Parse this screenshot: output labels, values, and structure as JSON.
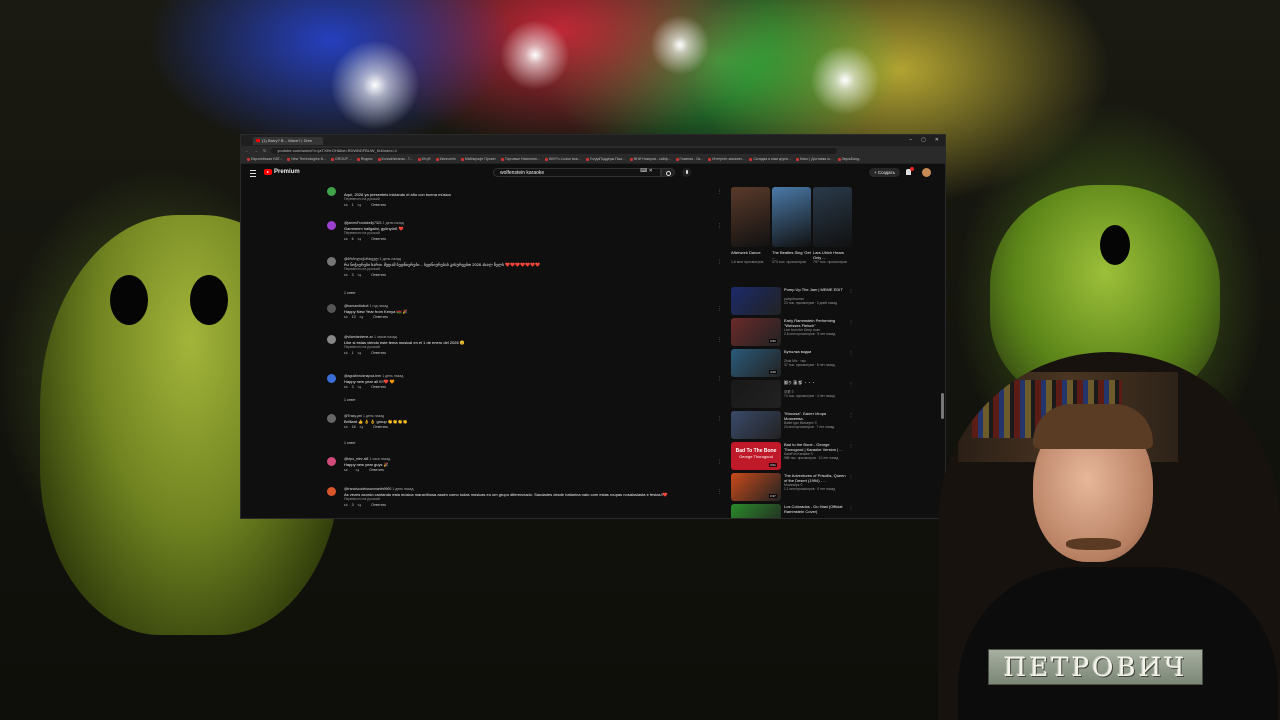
{
  "browser": {
    "tab_title": "(1) Barry? B... Wave? | Dhm",
    "url": "youtube.com/watch?v=jaTXlHrOH&list=RDWBDFBUW_Kl&index=1",
    "bookmarks": [
      "Европейская НАТ...",
      "New Technologies N...",
      "GROUP ...",
      "Яндекс",
      "КолоаИкеанак - Т...",
      "Ютуб",
      "Mannzmin",
      "Майнкрафт Проект",
      "Торговые Нахеолин...",
      "Will Fu Loulue мок...",
      "ГолдаПоддерж.Пыа...",
      "ВНИ Никоров - кайф...",
      "Главная - Ок...",
      "Интернет-магазин...",
      "Складка и коки кругм...",
      "Мясо | Доставка м...",
      "ЗвукаБанд.."
    ],
    "window_controls": [
      "–",
      "▢",
      "✕"
    ]
  },
  "youtube": {
    "logo": "Premium",
    "search_value": "wolfenstein karaoke",
    "create_label": "+ Создать"
  },
  "comments": [
    {
      "user": "",
      "time": "",
      "text": "Aquí, 2026 ya presenteis iniciando el año con buena música",
      "translate": "Перевести на русский",
      "likes": "1",
      "reply": "Ответить",
      "color": "#3fa34a"
    },
    {
      "user": "@jamesFrostabelly7321",
      "time": "1 день назад",
      "text": "Gammmm hallgatni, gyönyörű ❤️",
      "translate": "Перевести на русский",
      "likes": "6",
      "reply": "Ответить",
      "color": "#9b3fcf"
    },
    {
      "user": "@ბრძოლაქართველ",
      "time": "1 день назад",
      "text": "რა ნიჭიერები ხართ. მუდამ ბედნიერები... ბედნიერებას გისურვებთ 2026 ახალ წელს ❤️❤️❤️❤️❤️❤️❤️",
      "translate": "Перевести на русский",
      "likes": "3",
      "reply": "Ответить",
      "color": "#777777"
    },
    {
      "user": "@kamandiabu4",
      "time": "1 год назад",
      "text": "Happy New Year from Kenya 🇰🇪 🎉",
      "translate": "",
      "likes": "13",
      "reply": "Ответить",
      "color": "#555555"
    },
    {
      "user": "@vilamfanbene-zx",
      "time": "1 часов назад",
      "text": "Like si estas viendo este tema musical en el 1 de enero del 2026 😊",
      "translate": "Перевести на русский",
      "likes": "1",
      "reply": "Ответить",
      "color": "#888888"
    },
    {
      "user": "@agustinruiznapoa-tnm",
      "time": "1 день назад",
      "text": "Happy new year all !!!!❤️ 🧡",
      "translate": "",
      "likes": "3",
      "reply": "Ответить",
      "color": "#3a6fd8"
    },
    {
      "user": "@Tracy-pni",
      "time": "1 день назад",
      "text": "Brilliant 👍 👌 👌 group 👏👏👏👏",
      "translate": "",
      "likes": "16",
      "reply": "Ответить",
      "color": "#666666"
    },
    {
      "user": "@lepo_elev-st8",
      "time": "1 часа назад",
      "text": "Happy new year guys 🎉",
      "translate": "",
      "likes": "",
      "reply": "Ответить",
      "color": "#d04a7a"
    },
    {
      "user": "@franciscodelosanmartin9900",
      "time": "1 день назад",
      "text": "As vezes acordo cantando esta música maravilhosa assim como todas músicas eu um grupo diferenciado.  Saudades desde batlarina nato com estas roupas nosálusiasta e festas!!❤️",
      "translate": "Перевести на русский",
      "likes": "3",
      "reply": "Ответить",
      "color": "#d9562b"
    }
  ],
  "answers": [
    "1 ответ",
    "1 ответ",
    "1 ответ"
  ],
  "shorts": [
    {
      "title": "Afterwork Dance",
      "views": "1,6 млн просмотров",
      "color": "#5a3a2a"
    },
    {
      "title": "The Beatles Sing 'Get ...",
      "views": "373 тыс. просмотров",
      "color": "#4a7aa8"
    },
    {
      "title": "Lars Ulrich Hears Only ...",
      "views": "797 тыс. просмотров",
      "color": "#2a3a4a"
    }
  ],
  "recommended": [
    {
      "title": "Pump Up The Jam | MEME EDIT",
      "channel": "pumpitnormm",
      "meta": "23 тыс. просмотров · 3 дней назад",
      "duration": "",
      "color": "#1b2a6a"
    },
    {
      "title": "Early Rammstein Performing \"Weisses Fleisch\"",
      "channel": "Live from the Deep room",
      "meta": "2,6 млн просмотров · 5 лет назад",
      "duration": "3:52",
      "color": "#6a2a2a"
    },
    {
      "title": "Бутылка водки",
      "channel": "Zhuk Mix · тыс.",
      "meta": "37 тыс. просмотров · 6 лет назад",
      "duration": "4:20",
      "color": "#2a5a7a"
    },
    {
      "title": "翻り 蓮 都 ・・・",
      "channel": "卒業 ©",
      "meta": "74 тыс. просмотров · 4 лет назад",
      "duration": "",
      "color": "#181818"
    },
    {
      "title": "\"Mocosa\". Балет Игоря Моисеева.",
      "channel": "Ballet Igor Moiseyev ©",
      "meta": "24 млн просмотров · 7 лет назад",
      "duration": "",
      "color": "#3a4a6a"
    },
    {
      "title": "Bad to the Bone - George Thorogood | Karaoke Version | ...",
      "channel": "KaraFun Karaoke ©",
      "meta": "986 тыс. просмотров · 10 лет назад",
      "duration": "3:01",
      "color": "#c01a2a"
    },
    {
      "title": "The Adventures of Priscilla, Queen of the Desert (1994) - ...",
      "channel": "Movieclips ©",
      "meta": "1,1 млн просмотров · 6 лет назад",
      "duration": "3:37",
      "color": "#c84a1a"
    },
    {
      "title": "Los Colorados - Du Hast (Official Rammstein Cover)",
      "channel": "",
      "meta": "",
      "duration": "",
      "color": "#2a8a2a"
    }
  ],
  "thumbnail_text": {
    "bad_to_the_bone": "Bad To The Bone",
    "george": "George Thorogood"
  },
  "overlay": {
    "nameplate": "ПЕТРОВИЧ"
  }
}
